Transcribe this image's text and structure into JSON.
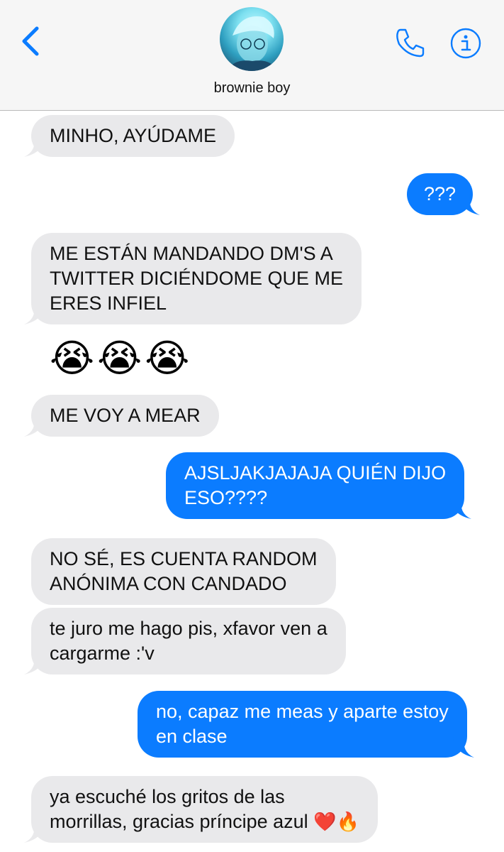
{
  "header": {
    "contact_name": "brownie boy",
    "icons": {
      "back": "chevron-left-icon",
      "call": "phone-icon",
      "info": "info-icon"
    },
    "accent_color": "#0b7cff"
  },
  "messages": [
    {
      "id": "m1",
      "side": "incoming",
      "lines": [
        "MINHO, AYÚDAME"
      ]
    },
    {
      "id": "m2",
      "side": "outgoing",
      "lines": [
        "???"
      ]
    },
    {
      "id": "m3",
      "side": "incoming",
      "lines": [
        "ME ESTÁN MANDANDO DM'S A",
        "TWITTER DICIÉNDOME QUE ME",
        "ERES INFIEL"
      ]
    },
    {
      "id": "m4",
      "side": "incoming",
      "emoji": [
        "😭",
        "😭",
        "😭"
      ]
    },
    {
      "id": "m5",
      "side": "incoming",
      "lines": [
        "ME VOY A MEAR"
      ]
    },
    {
      "id": "m6",
      "side": "outgoing",
      "lines": [
        "AJSLJAKJAJAJA QUIÉN DIJO",
        "ESO????"
      ]
    },
    {
      "id": "m7",
      "side": "incoming",
      "lines": [
        "NO SÉ, ES CUENTA RANDOM",
        "ANÓNIMA CON CANDADO"
      ]
    },
    {
      "id": "m8",
      "side": "incoming",
      "lines": [
        "te juro me hago pis, xfavor ven a",
        "cargarme :'v"
      ]
    },
    {
      "id": "m9",
      "side": "outgoing",
      "lines": [
        "no, capaz me meas y aparte estoy",
        "en clase"
      ]
    },
    {
      "id": "m10",
      "side": "incoming",
      "lines": [
        "ya escuché los gritos de las",
        "morrillas, gracias príncipe azul"
      ],
      "trailing_emoji": [
        "❤️",
        "🔥"
      ]
    }
  ],
  "colors": {
    "incoming_bubble": "#e9e9eb",
    "outgoing_bubble": "#0b7cff",
    "outgoing_text": "#ffffff"
  }
}
